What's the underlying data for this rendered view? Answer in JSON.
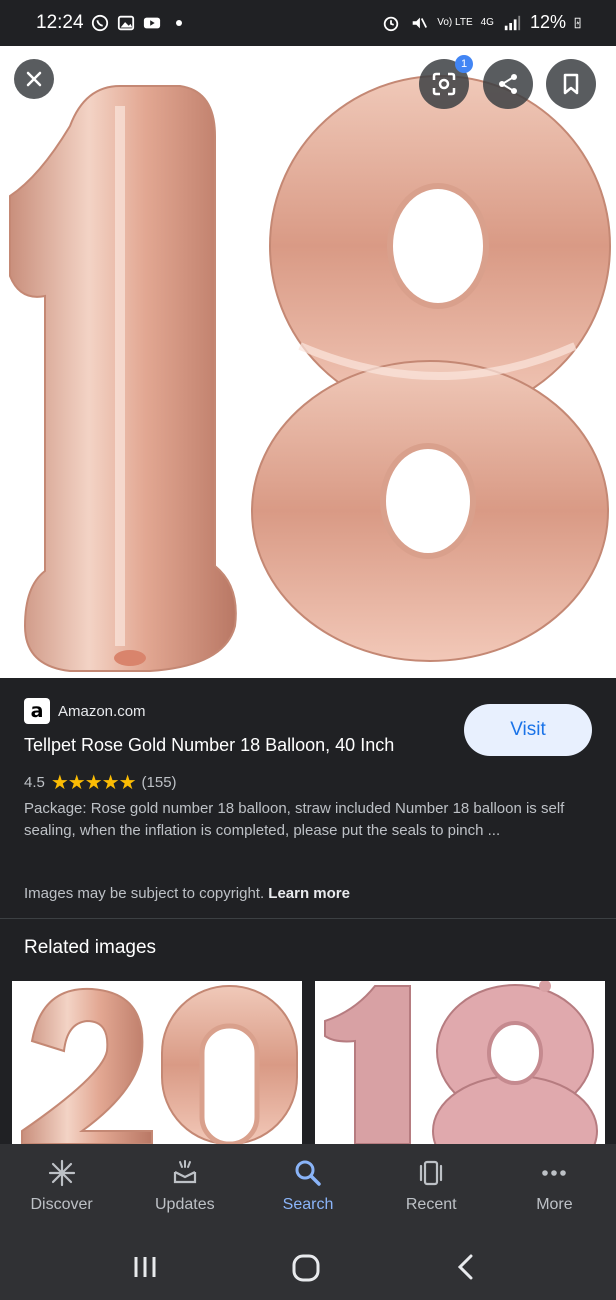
{
  "status_bar": {
    "time": "12:24",
    "network": "Vo) LTE",
    "signal_type": "4G",
    "battery": "12%"
  },
  "overlay": {
    "lens_badge_count": "1"
  },
  "result": {
    "source": "Amazon.com",
    "source_logo": "a",
    "title": "Tellpet Rose Gold Number 18 Balloon, 40 Inch",
    "visit_label": "Visit",
    "rating": "4.5",
    "rating_fraction": 0.9,
    "reviews": "(155)",
    "description": "Package: Rose gold number 18 balloon, straw included Number 18 balloon is self sealing, when the inflation is completed, please put the seals to pinch ...",
    "copyright_text": "Images may be subject to copyright.",
    "learn_more": "Learn more"
  },
  "related": {
    "heading": "Related images"
  },
  "bottom_nav": {
    "items": [
      {
        "label": "Discover",
        "icon": "asterisk-icon"
      },
      {
        "label": "Updates",
        "icon": "updates-icon"
      },
      {
        "label": "Search",
        "icon": "search-icon",
        "active": true
      },
      {
        "label": "Recent",
        "icon": "recent-icon"
      },
      {
        "label": "More",
        "icon": "more-dots-icon"
      }
    ]
  },
  "colors": {
    "background": "#202124",
    "accent": "#8ab4f8",
    "visit_bg": "#e8f0fe",
    "star": "#fbbc04",
    "balloon": "#e6b4a2"
  }
}
